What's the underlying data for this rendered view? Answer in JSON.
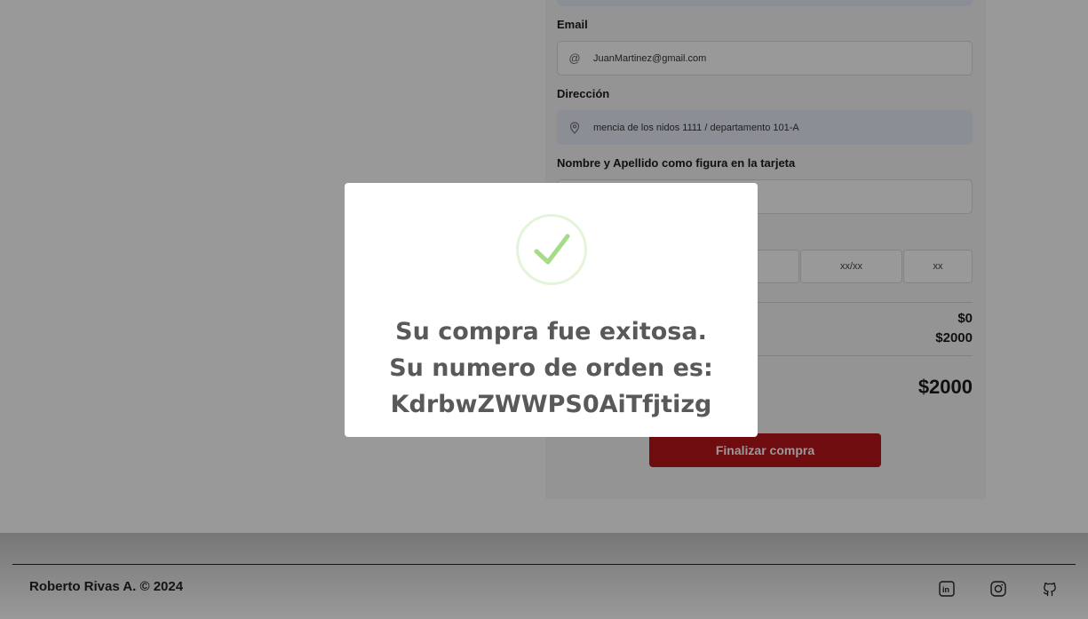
{
  "form": {
    "email_label": "Email",
    "email_value": "JuanMartinez@gmail.com",
    "address_label": "Dirección",
    "address_value": "mencia de los nidos 1111  / departamento 101-A",
    "cardholder_label": "Nombre y Apellido como figura en la tarjeta",
    "expiry_placeholder": "xx/xx",
    "cvv_placeholder": "xx"
  },
  "summary": {
    "shipping_amount": "$0",
    "subtotal_amount": "$2000",
    "total_amount": "$2000"
  },
  "actions": {
    "finalize_label": "Finalizar compra"
  },
  "footer": {
    "copyright": "Roberto Rivas A. © 2024",
    "social_icons": [
      "linkedin-icon",
      "instagram-icon",
      "github-icon"
    ]
  },
  "modal": {
    "line1": "Su compra fue exitosa.",
    "line2": "Su numero de orden es:",
    "order_id": "KdrbwZWWPS0AiTfjtizg"
  },
  "colors": {
    "accent": "#b8141b",
    "success": "#a5dc86",
    "overlay": "rgba(0,0,0,0.4)"
  }
}
